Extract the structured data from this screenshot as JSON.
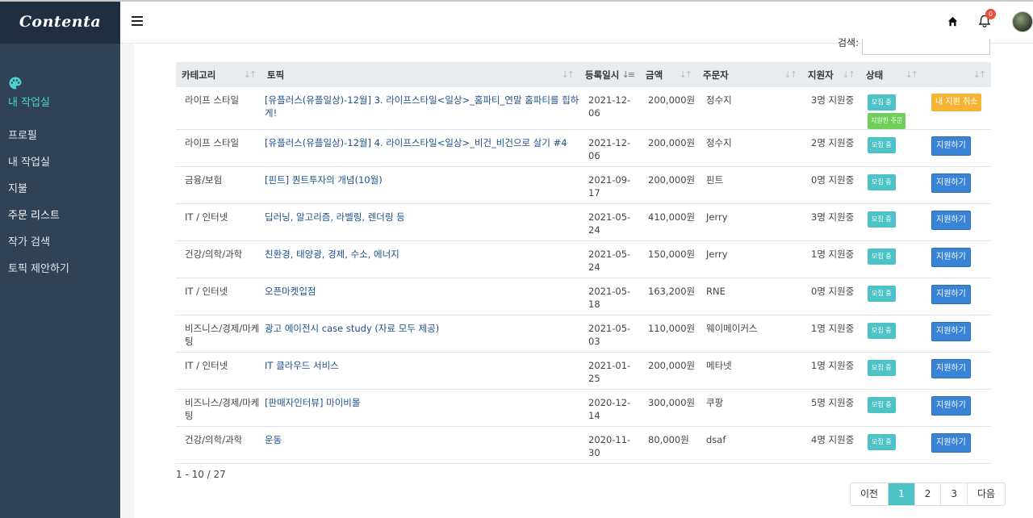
{
  "brand": "Contenta",
  "sidebar": {
    "section_title": "내 작업실",
    "items": [
      {
        "label": "프로필"
      },
      {
        "label": "내 작업실"
      },
      {
        "label": "지불"
      },
      {
        "label": "주문 리스트"
      },
      {
        "label": "작가 검색"
      },
      {
        "label": "토픽 제안하기"
      }
    ]
  },
  "header": {
    "notification_count": "0"
  },
  "search": {
    "label": "검색:",
    "value": ""
  },
  "table": {
    "columns": [
      "카테고리",
      "토픽",
      "등록일시",
      "금액",
      "주문자",
      "지원자",
      "상태",
      ""
    ],
    "rows": [
      {
        "category": "라이프 스타일",
        "topic": "[유플러스(유플일상)-12월] 3. 라이프스타일<일상>_홈파티_연말 홈파티를 힙하게!",
        "date": "2021-12-06",
        "amount": "200,000원",
        "orderer": "정수지",
        "applicants": "3명 지원중",
        "status": "모집 중",
        "status2": "지원한 주문",
        "action": "내 지원 취소",
        "action_type": "cancel"
      },
      {
        "category": "라이프 스타일",
        "topic": "[유플러스(유플일상)-12월] 4. 라이프스타일<일상>_비건_비건으로 살기 #4",
        "date": "2021-12-06",
        "amount": "200,000원",
        "orderer": "정수지",
        "applicants": "2명 지원중",
        "status": "모집 중",
        "status2": "",
        "action": "지원하기",
        "action_type": "apply"
      },
      {
        "category": "금융/보험",
        "topic": "[핀트] 퀀트투자의 개념(10월)",
        "date": "2021-09-17",
        "amount": "200,000원",
        "orderer": "핀트",
        "applicants": "0명 지원중",
        "status": "모집 중",
        "status2": "",
        "action": "지원하기",
        "action_type": "apply"
      },
      {
        "category": "IT / 인터넷",
        "topic": "딥러닝, 알고리즘, 라벨링, 렌더링 등",
        "date": "2021-05-24",
        "amount": "410,000원",
        "orderer": "Jerry",
        "applicants": "3명 지원중",
        "status": "모집 중",
        "status2": "",
        "action": "지원하기",
        "action_type": "apply"
      },
      {
        "category": "건강/의학/과학",
        "topic": "친환경, 태양광, 경제, 수소, 에너지",
        "date": "2021-05-24",
        "amount": "150,000원",
        "orderer": "Jerry",
        "applicants": "1명 지원중",
        "status": "모집 중",
        "status2": "",
        "action": "지원하기",
        "action_type": "apply"
      },
      {
        "category": "IT / 인터넷",
        "topic": "오픈마켓입점",
        "date": "2021-05-18",
        "amount": "163,200원",
        "orderer": "RNE",
        "applicants": "0명 지원중",
        "status": "모집 중",
        "status2": "",
        "action": "지원하기",
        "action_type": "apply"
      },
      {
        "category": "비즈니스/경제/마케팅",
        "topic": "광고 에이전시 case study (자료 모두 제공)",
        "date": "2021-05-03",
        "amount": "110,000원",
        "orderer": "웨이메이커스",
        "applicants": "1명 지원중",
        "status": "모집 중",
        "status2": "",
        "action": "지원하기",
        "action_type": "apply"
      },
      {
        "category": "IT / 인터넷",
        "topic": "IT 클라우드 서비스",
        "date": "2021-01-25",
        "amount": "200,000원",
        "orderer": "메타넷",
        "applicants": "1명 지원중",
        "status": "모집 중",
        "status2": "",
        "action": "지원하기",
        "action_type": "apply"
      },
      {
        "category": "비즈니스/경제/마케팅",
        "topic": "[판매자인터뷰] 마이비몰",
        "date": "2020-12-14",
        "amount": "300,000원",
        "orderer": "쿠팡",
        "applicants": "5명 지원중",
        "status": "모집 중",
        "status2": "",
        "action": "지원하기",
        "action_type": "apply"
      },
      {
        "category": "건강/의학/과학",
        "topic": "운동",
        "date": "2020-11-30",
        "amount": "80,000원",
        "orderer": "dsaf",
        "applicants": "4명 지원중",
        "status": "모집 중",
        "status2": "",
        "action": "지원하기",
        "action_type": "apply"
      }
    ]
  },
  "footer": {
    "range": "1 - 10 / 27",
    "pager": [
      "이전",
      "1",
      "2",
      "3",
      "다음"
    ],
    "current_page": "1"
  },
  "colors": {
    "sidebar": "#2f4256",
    "accent": "#4ec3c7",
    "apply": "#3a84d8",
    "cancel": "#f4b434"
  }
}
